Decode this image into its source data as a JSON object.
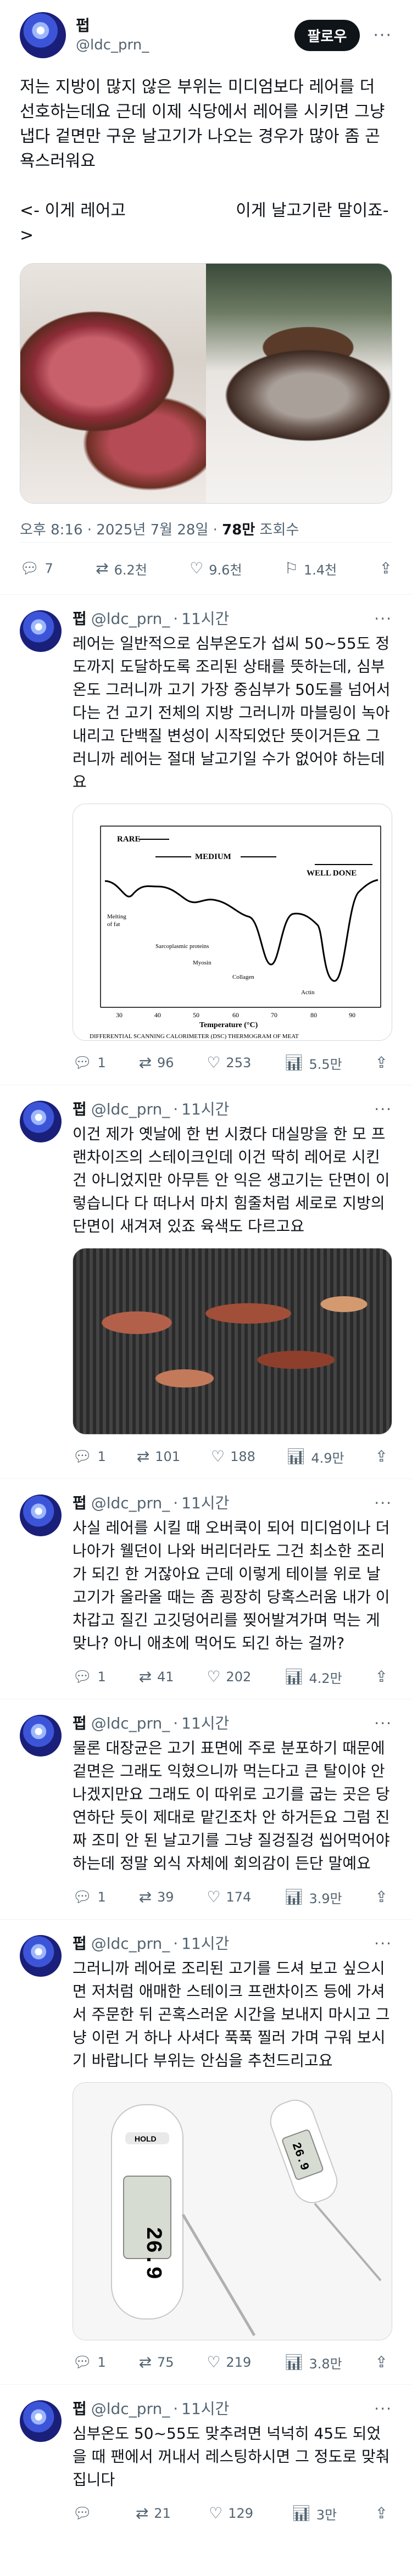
{
  "post": {
    "author": "펍",
    "handle": "@ldc_prn_",
    "follow": "팔로우",
    "more": "···",
    "text": "저는 지방이 많지 않은 부위는 미디엄보다 레어를 더 선호하는데요 근데 이제 식당에서 레어를 시키면 그냥 냅다 겉면만 구운 날고기가 나오는 경우가 많아 좀 곤욕스러워요\n\n<- 이게 레어고                     이게 날고기란 말이죠->",
    "meta_time": "오후 8:16 · 2025년 7월 28일 · ",
    "meta_views": "78만",
    "meta_views_label": " 조회수",
    "actions": {
      "reply": "7",
      "retweet": "6.2천",
      "like": "9.6천",
      "bookmark": "1.4천"
    }
  },
  "replies": [
    {
      "name": "펍",
      "handle": "@ldc_prn_",
      "time": "11시간",
      "text": "레어는 일반적으로 심부온도가 섭씨 50~55도 정도까지 도달하도록 조리된 상태를 뜻하는데, 심부온도 그러니까 고기 가장 중심부가 50도를 넘어서다는 건 고기 전체의 지방 그러니까 마블링이 녹아내리고 단백질 변성이 시작되었단 뜻이거든요 그러니까 레어는 절대 날고기일 수가 없어야 하는데요",
      "reply": "1",
      "retweet": "96",
      "like": "253",
      "views": "5.5만"
    },
    {
      "name": "펍",
      "handle": "@ldc_prn_",
      "time": "11시간",
      "text": "이건 제가 옛날에 한 번 시켰다 대실망을 한 모 프랜차이즈의 스테이크인데 이건 딱히 레어로 시킨 건 아니었지만 아무튼 안 익은 생고기는 단면이 이렇습니다 다 떠나서 마치 힘줄처럼 세로로 지방의 단면이 새겨져 있죠 육색도 다르고요",
      "reply": "1",
      "retweet": "101",
      "like": "188",
      "views": "4.9만"
    },
    {
      "name": "펍",
      "handle": "@ldc_prn_",
      "time": "11시간",
      "text": "사실 레어를 시킬 때 오버쿡이 되어 미디엄이나 더 나아가 웰던이 나와 버리더라도 그건 최소한 조리가 되긴 한 거잖아요 근데 이렇게 테이블 위로 날고기가 올라올 때는 좀 굉장히 당혹스러움 내가 이 차갑고 질긴 고깃덩어리를 찢어발겨가며 먹는 게 맞나? 아니 애초에 먹어도 되긴 하는 걸까?",
      "reply": "1",
      "retweet": "41",
      "like": "202",
      "views": "4.2만"
    },
    {
      "name": "펍",
      "handle": "@ldc_prn_",
      "time": "11시간",
      "text": "물론 대장균은 고기 표면에 주로 분포하기 때문에 겉면은 그래도 익혔으니까 먹는다고 큰 탈이야 안 나겠지만요 그래도 이 따위로 고기를 굽는 곳은 당연하단 듯이 제대로 맡긴조차 안 하거든요 그럼 진짜 조미 안 된 날고기를 그냥 질겅질겅 씹어먹어야 하는데 정말 외식 자체에 회의감이 든단 말예요",
      "reply": "1",
      "retweet": "39",
      "like": "174",
      "views": "3.9만"
    },
    {
      "name": "펍",
      "handle": "@ldc_prn_",
      "time": "11시간",
      "text": "그러니까 레어로 조리된 고기를 드셔 보고 싶으시면 저처럼 애매한 스테이크 프랜차이즈 등에 가셔서 주문한 뒤 곤혹스러운 시간을 보내지 마시고 그냥 이런 거 하나 사셔다 푹푹 찔러 가며 구워 보시기 바랍니다 부위는 안심을 추천드리고요",
      "reply": "1",
      "retweet": "75",
      "like": "219",
      "views": "3.8만"
    },
    {
      "name": "펍",
      "handle": "@ldc_prn_",
      "time": "11시간",
      "text": "심부온도 50~55도 맞추려면 넉넉히 45도 되었을 때 팬에서 꺼내서 레스팅하시면 그 정도로 맞춰집니다",
      "reply": "",
      "retweet": "21",
      "like": "129",
      "views": "3만"
    }
  ],
  "dsc_chart": {
    "label_rare": "RARE",
    "label_medium": "MEDIUM",
    "label_welldone": "WELL DONE",
    "label_fat": "Melting\nof fat",
    "label_sarco": "Sarcoplasmic proteins",
    "label_myosin": "Myosin",
    "label_collagen": "Collagen",
    "label_actin": "Actin",
    "xlabel": "Temperature (°C)",
    "caption": "DIFFERENTIAL SCANNING CALORIMETER (DSC) THERMOGRAM OF MEAT",
    "ticks": [
      "30",
      "40",
      "50",
      "60",
      "70",
      "80",
      "90"
    ]
  },
  "thermo": {
    "display_big": "26.9",
    "display_small": "26.9",
    "hold": "HOLD",
    "power": "ON/OFF"
  }
}
